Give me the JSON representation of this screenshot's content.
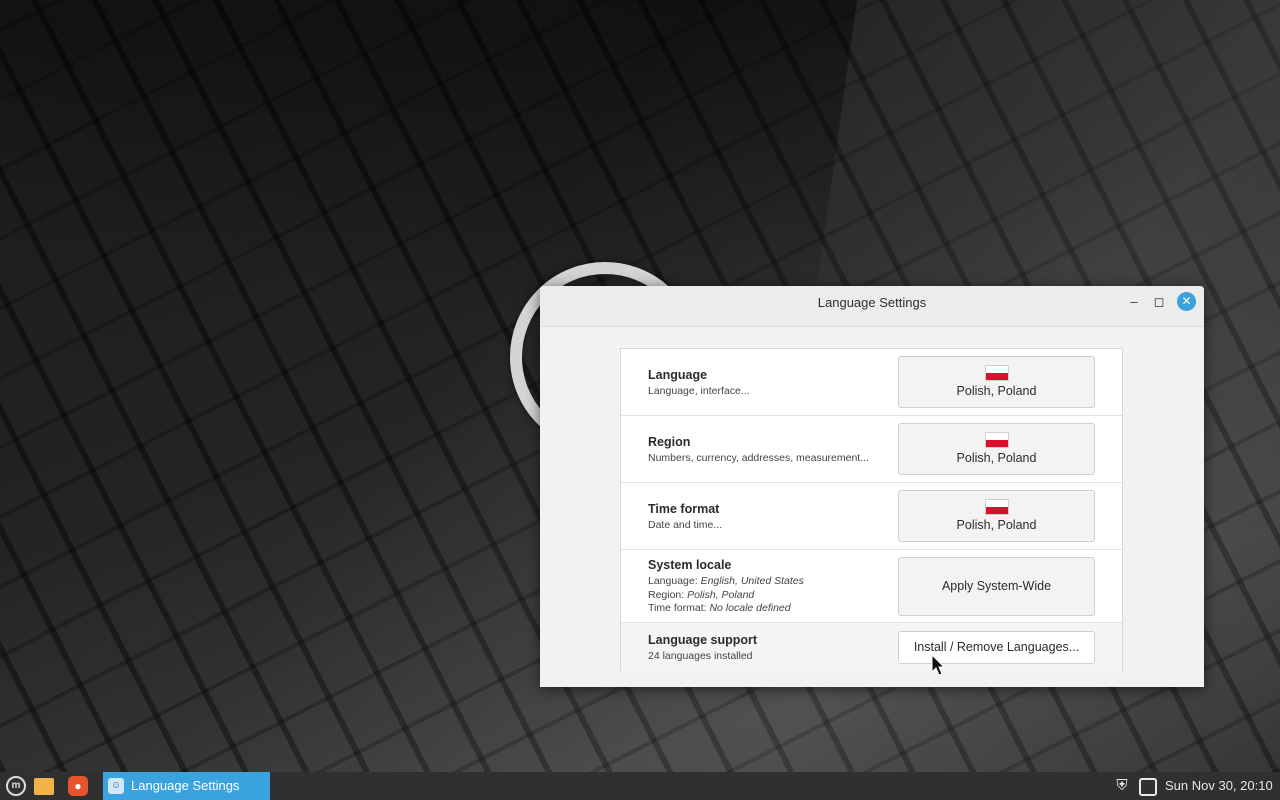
{
  "window": {
    "title": "Language Settings"
  },
  "rows": [
    {
      "title": "Language",
      "desc": "Language, interface...",
      "button": "Polish, Poland"
    },
    {
      "title": "Region",
      "desc": "Numbers, currency, addresses, measurement...",
      "button": "Polish, Poland"
    },
    {
      "title": "Time format",
      "desc": "Date and time...",
      "button": "Polish, Poland"
    },
    {
      "title": "System locale",
      "locale_language_key": "Language:",
      "locale_language_val": "English, United States",
      "locale_region_key": "Region:",
      "locale_region_val": "Polish, Poland",
      "locale_time_key": "Time format:",
      "locale_time_val": "No locale defined",
      "button": "Apply System-Wide"
    },
    {
      "title": "Language support",
      "desc": "24 languages installed",
      "button": "Install / Remove Languages..."
    }
  ],
  "taskbar": {
    "active_task": "Language Settings",
    "clock": "Sun Nov 30, 20:10"
  },
  "icons": {
    "flag": "poland-flag-icon",
    "menu": "mint-menu-icon",
    "files": "folder-icon",
    "browser": "firefox-icon",
    "shield": "shield-icon",
    "notifications": "notification-icon"
  },
  "colors": {
    "accent": "#3aa2dc",
    "flag_red": "#d9112a"
  }
}
